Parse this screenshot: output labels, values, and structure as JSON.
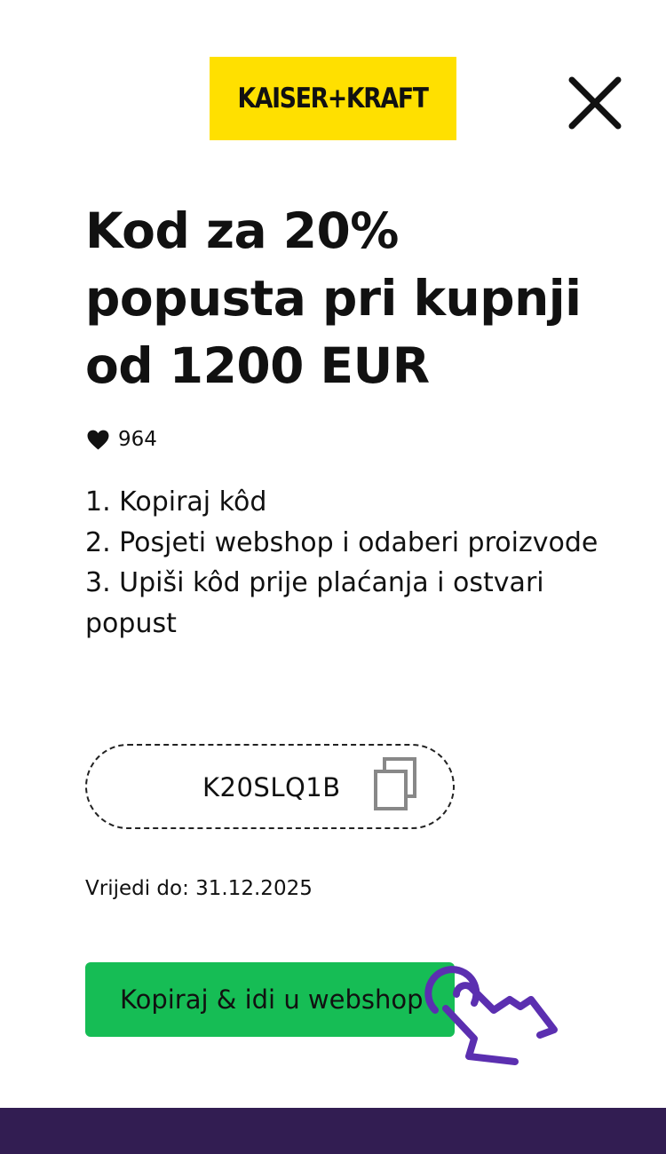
{
  "brand": {
    "logo_text": "KAISER+KRAFT",
    "logo_bg": "#ffe000"
  },
  "close_icon": "close-icon",
  "offer": {
    "title": "Kod za 20% popusta pri kupnji od 1200 EUR",
    "likes_icon": "heart-icon",
    "likes": "964"
  },
  "steps": [
    "1. Kopiraj kôd",
    "2. Posjeti webshop i odaberi proizvode",
    "3. Upiši kôd prije plaćanja i ostvari popust"
  ],
  "coupon": {
    "code": "K20SLQ1B",
    "copy_icon": "copy-icon"
  },
  "validity": "Vrijedi do: 31.12.2025",
  "cta": {
    "label": "Kopiraj & idi u webshop",
    "color": "#16bd55",
    "hand_icon": "hand-pointer-icon",
    "hand_color": "#5b2fb0"
  },
  "footer_bar_color": "#321d52"
}
